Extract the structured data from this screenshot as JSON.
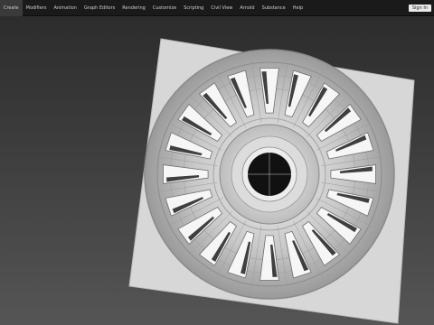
{
  "menubar": {
    "items": [
      "Create",
      "Modifiers",
      "Animation",
      "Graph Editors",
      "Rendering",
      "Customize",
      "Scripting",
      "Civil View",
      "Arnold",
      "Substance",
      "Help"
    ],
    "sign_in": "Sign In"
  },
  "viewport": {
    "background_top": "#2a2a2a",
    "background_bottom": "#555555",
    "plane_color": "#d7d7d7",
    "wheel_color": "#c8c8c8",
    "hub_color": "#111111"
  }
}
